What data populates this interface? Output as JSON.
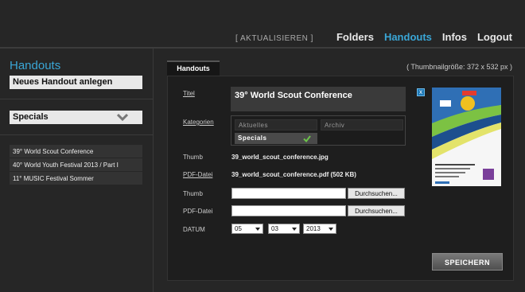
{
  "nav": {
    "refresh": "[ AKTUALISIEREN ]",
    "items": [
      "Folders",
      "Handouts",
      "Infos",
      "Logout"
    ],
    "active": "Handouts"
  },
  "sidebar": {
    "title": "Handouts",
    "new_button": "Neues Handout anlegen",
    "category_select": "Specials",
    "items": [
      "39° World Scout Conference",
      "40° World Youth Festival 2013 / Part I",
      "11° MUSIC Festival Sommer"
    ]
  },
  "panel": {
    "tab": "Handouts",
    "thumb_size": "( Thumbnailgröße: 372 x 532 px )",
    "labels": {
      "titel": "Titel",
      "kategorien": "Kategorien",
      "thumb": "Thumb",
      "pdf": "PDF-Datei",
      "thumb_upload": "Thumb",
      "pdf_upload": "PDF-Datei",
      "datum": "DATUM"
    },
    "title_value": "39° World Scout Conference",
    "categories": [
      {
        "label": "Aktuelles",
        "selected": false
      },
      {
        "label": "Archiv",
        "selected": false
      },
      {
        "label": "Specials",
        "selected": true
      }
    ],
    "thumb_file": "39_world_scout_conference.jpg",
    "pdf_file": "39_world_scout_conference.pdf (502 KB)",
    "browse_label": "Durchsuchen...",
    "date": {
      "day": "05",
      "month": "03",
      "year": "2013"
    },
    "close": "x",
    "save": "SPEICHERN"
  },
  "colors": {
    "accent": "#3aa6d6",
    "check": "#6cc24a"
  }
}
